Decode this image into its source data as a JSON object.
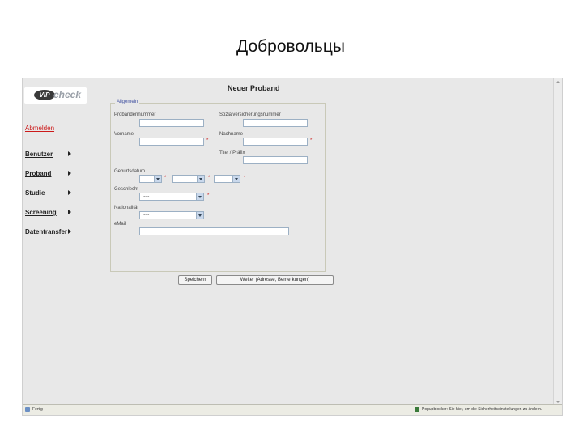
{
  "slide": {
    "title": "Добровольцы"
  },
  "app": {
    "logo": {
      "mark": "VIP",
      "wordmark": "check"
    },
    "page_title": "Neuer Proband",
    "nav": {
      "logout": "Abmelden",
      "items": [
        {
          "label": "Benutzer"
        },
        {
          "label": "Proband"
        },
        {
          "label": "Studie"
        },
        {
          "label": "Screening"
        },
        {
          "label": "Datentransfer"
        }
      ]
    },
    "form": {
      "legend": "Allgemein",
      "probandennummer": {
        "label": "Probandennummer",
        "value": ""
      },
      "sozialversicherungsnummer": {
        "label": "Sozialversicherungsnummer",
        "value": ""
      },
      "vorname": {
        "label": "Vorname",
        "value": "",
        "required_mark": "*"
      },
      "nachname": {
        "label": "Nachname",
        "value": "",
        "required_mark": "*"
      },
      "titel": {
        "label": "Titel / Präfix",
        "value": ""
      },
      "geburtsdatum": {
        "label": "Geburtsdatum",
        "required_mark": "*"
      },
      "geschlecht": {
        "label": "Geschlecht",
        "selected": "-----",
        "required_mark": "*"
      },
      "nationalitaet": {
        "label": "Nationalität",
        "selected": "-----"
      },
      "email": {
        "label": "eMail",
        "value": ""
      }
    },
    "buttons": {
      "save": "Speichern",
      "next": "Weiter (Adresse, Bemerkungen)"
    },
    "statusbar": {
      "left": "Fertig",
      "right": "Popupblocker: Sie hier, um die Sicherheitseinstellungen zu ändern."
    }
  }
}
